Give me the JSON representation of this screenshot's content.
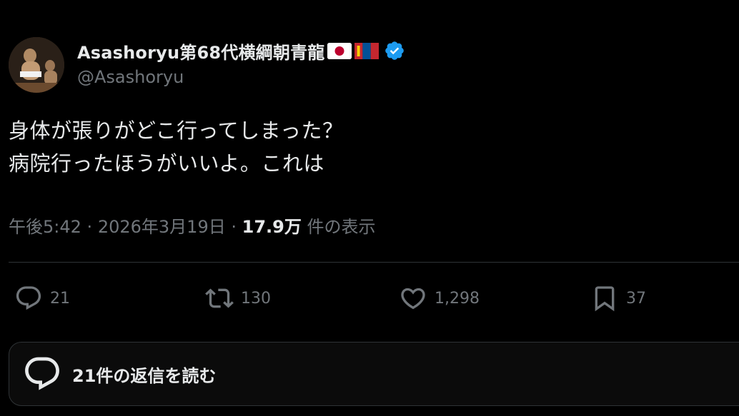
{
  "author": {
    "display_name": "Asashoryu第68代横綱朝青龍",
    "handle": "@Asashoryu",
    "flags": [
      "japan-flag",
      "mongolia-flag"
    ],
    "verified": true
  },
  "post": {
    "lines": [
      "身体が張りがどこ行ってしまった？",
      "病院行ったほうがいいよ。これは"
    ]
  },
  "meta": {
    "time": "午後5:42",
    "separator": "·",
    "date": "2026年3月19日",
    "views": "17.9万",
    "views_suffix": "件の表示"
  },
  "actions": {
    "reply": {
      "icon": "reply-icon",
      "count": "21"
    },
    "repost": {
      "icon": "repost-icon",
      "count": "130"
    },
    "like": {
      "icon": "heart-icon",
      "count": "1,298"
    },
    "bookmark": {
      "icon": "bookmark-icon",
      "count": "37"
    }
  },
  "replies_button": {
    "icon": "reply-bubble-icon",
    "label": "21件の返信を読む"
  },
  "colors": {
    "background": "#000000",
    "text": "#e7e9ea",
    "muted": "#71767b",
    "divider": "#2f3336",
    "verified": "#1d9bf0"
  }
}
